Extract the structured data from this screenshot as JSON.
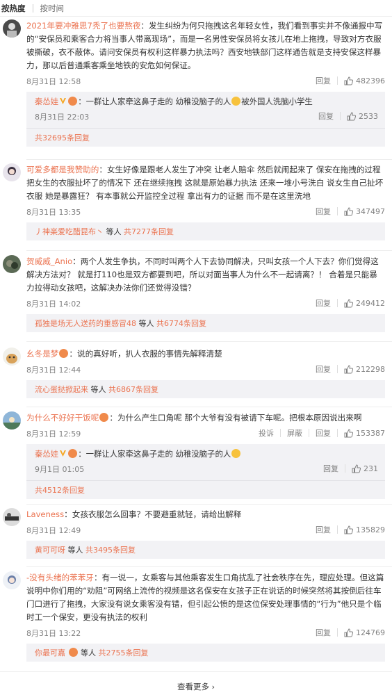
{
  "sort": {
    "hot": "按热度",
    "time": "按时间"
  },
  "labels": {
    "reply": "回复",
    "report": "投诉",
    "block": "屏蔽",
    "waiting": "等人"
  },
  "comments": [
    {
      "user": "2021年要冲雅思7秃了也要熬夜",
      "text": "：发生纠纷为何只拖拽这名年轻女性，我们看到事实并不像通报中写的“安保员和乘客合力将当事人带离现场”，而是一名男性安保员将女孩儿在地上拖拽，导致对方衣服被撕破，衣不蔽体。请问安保员有权利这样暴力执法吗？西安地铁部门这样通告就是支持安保这样暴力，那以后普通乘客乘坐地铁的安危如何保证。",
      "date": "8月31日 12:58",
      "likes": "482396",
      "reply": {
        "user": "秦怂娃",
        "text": "：一群让人家牵这鼻子走的 幼稚没脑子的人",
        "text2": "被外国人洗脑小学生",
        "date": "8月31日 22:03",
        "likes": "2533"
      },
      "more": "共32695条回复"
    },
    {
      "user": "可爱多都是我赞助的",
      "text": "：女生好像是跟老人发生了冲突 让老人赔伞 然后就闹起来了 保安在拖拽的过程把女生的衣服扯坏了的情况下 还在继续拖拽 这就是原始暴力执法 还来一堆小号洗白 说女生自己扯坏衣服 她是暴露狂？ 有本事就公开监控全过程 拿出有力的证据 而不是在这里洗地",
      "date": "8月31日 13:35",
      "likes": "347497",
      "moreUser": "丿神楽爱吃醋昆布丶",
      "more": "共7277条回复"
    },
    {
      "user": "贺威威_Anio",
      "text": "：两个人发生争执，不同时叫两个人下去协同解决，只叫女孩一个人下去？你们觉得这解决方法对？ 就是打110也是双方都要到吧，所以对面当事人为什么不一起请离？！ 合着是只能暴力拉得动女孩吧，这解决办法你们还觉得没错？",
      "date": "8月31日 14:02",
      "likes": "249412",
      "moreUser": "孤独是场无人送药的重感冒48",
      "more": "共6774条回复"
    },
    {
      "user": "幺冬是梦",
      "text": "：说的真好听，扒人衣服的事情先解释清楚",
      "date": "8月31日 12:44",
      "likes": "212298",
      "moreUser": "流心蛋挞掀起来",
      "more": "共6867条回复"
    },
    {
      "user": "为什么不好好干饭呢",
      "text": "：为什么产生口角呢 那个大爷有没有被请下车呢。把根本原因说出来啊",
      "date": "8月31日 12:59",
      "likes": "153387",
      "reply": {
        "user": "秦怂娃",
        "text": "：一群让人家牵这鼻子走的 幼稚没脑子的人",
        "date": "9月1日 01:05",
        "likes": "231"
      },
      "more": "共4512条回复"
    },
    {
      "user": "Laveness",
      "text": "：女孩衣服怎么回事？不要避重就轻，请给出解释",
      "date": "8月31日 12:49",
      "likes": "135829",
      "moreUser": "黄可可呀",
      "more": "共3495条回复"
    },
    {
      "user": "-没有头绪的苯苯牙",
      "text": "：有一说一，女乘客与其他乘客发生口角扰乱了社会秩序在先，理应处理。但这篇说明中你们用的“劝阻”可网络上流传的视频是这名保安在女孩子正在说话的时候突然将其按倒后往车门口进行了拖拽，大家没有说女乘客没有错，但引起公愤的是这位保安处理事情的“行为”他只是个临时工一个保安，更没有执法的权利",
      "date": "8月31日 13:22",
      "likes": "124769",
      "moreUser": "你最可嘉",
      "more": "共2755条回复"
    }
  ],
  "seeMore": "查看更多",
  "colors": {
    "accent": "#eb7350",
    "replyBg": "#f2f2f5",
    "meta": "#808080"
  }
}
